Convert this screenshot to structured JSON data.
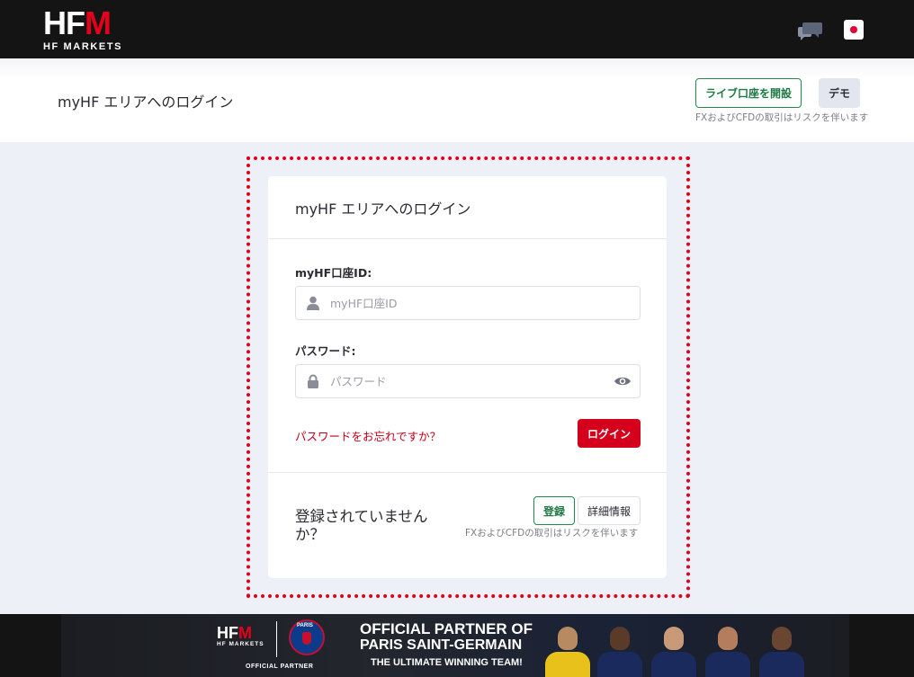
{
  "brand": {
    "logo_hf": "HF",
    "logo_m": "M",
    "logo_sub": "HF MARKETS"
  },
  "header": {
    "title": "myHF エリアへのログイン",
    "live_account_label": "ライブ口座を開設",
    "demo_label": "デモ",
    "risk_notice": "FXおよびCFDの取引はリスクを伴います"
  },
  "login_card": {
    "title": "myHF エリアへのログイン",
    "account_id_label": "myHF口座ID:",
    "account_id_placeholder": "myHF口座ID",
    "password_label": "パスワード:",
    "password_placeholder": "パスワード",
    "forgot_password": "パスワードをお忘れですか？",
    "login_button": "ログイン",
    "not_registered": "登録されていませんか？",
    "register_button": "登録",
    "details_button": "詳細情報",
    "risk_notice": "FXおよびCFDの取引はリスクを伴います"
  },
  "banner": {
    "logo_hf": "HF",
    "logo_m": "M",
    "logo_sub": "HF MARKETS",
    "official_partner": "OFFICIAL PARTNER",
    "club_label": "PARIS",
    "line1": "OFFICIAL PARTNER OF",
    "line2": "PARIS SAINT-GERMAIN",
    "line3": "THE ULTIMATE WINNING TEAM!"
  },
  "icons": {
    "chat": "chat-icon",
    "language": "japan-flag-icon",
    "user": "user-icon",
    "lock": "lock-icon",
    "visibility": "eye-icon"
  },
  "colors": {
    "brand_red": "#e3001b",
    "login_red": "#d4001c",
    "accent_green": "#1f8a4c",
    "topbar": "#141414",
    "page_bg": "#eef0f7"
  }
}
